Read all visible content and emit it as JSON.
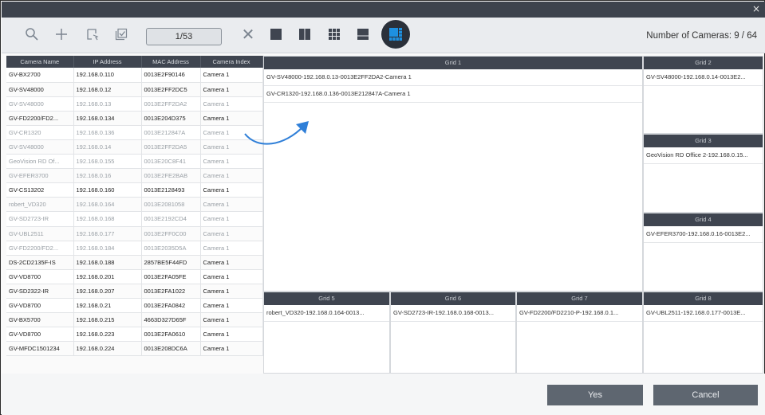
{
  "dialog": {
    "close_glyph": "×",
    "colors": {
      "titlebar": "#3d434d",
      "header": "#3f4550",
      "active_layout": "#1e90e0",
      "button": "#5e6670"
    }
  },
  "toolbar": {
    "icons": [
      "search-icon",
      "add-icon",
      "select-area-icon",
      "select-all-icon"
    ],
    "page_indicator": "1/53",
    "clear_glyph": "✕",
    "layouts": [
      "layout-1x1-icon",
      "layout-2x1-icon",
      "layout-3x3-icon",
      "layout-1plus2-icon",
      "layout-1plus7-icon"
    ],
    "camera_count": "Number of Cameras: 9 / 64"
  },
  "table": {
    "headers": [
      "Camera Name",
      "IP Address",
      "MAC Address",
      "Camera Index"
    ],
    "rows": [
      [
        "GV-BX2700",
        "192.168.0.110",
        "0013E2F90146",
        "Camera 1"
      ],
      [
        "GV-SV48000",
        "192.168.0.12",
        "0013E2FF2DC5",
        "Camera 1"
      ],
      [
        "GV-SV48000",
        "192.168.0.13",
        "0013E2FF2DA2",
        "Camera 1"
      ],
      [
        "GV-FD2200/FD2...",
        "192.168.0.134",
        "0013E204D375",
        "Camera 1"
      ],
      [
        "GV-CR1320",
        "192.168.0.136",
        "0013E212847A",
        "Camera 1"
      ],
      [
        "GV-SV48000",
        "192.168.0.14",
        "0013E2FF2DA5",
        "Camera 1"
      ],
      [
        "GeoVision RD Of...",
        "192.168.0.155",
        "0013E20C8F41",
        "Camera 1"
      ],
      [
        "GV-EFER3700",
        "192.168.0.16",
        "0013E2FE2BAB",
        "Camera 1"
      ],
      [
        "GV-CS13202",
        "192.168.0.160",
        "0013E2128493",
        "Camera 1"
      ],
      [
        "robert_VD320",
        "192.168.0.164",
        "0013E2081058",
        "Camera 1"
      ],
      [
        "GV-SD2723-IR",
        "192.168.0.168",
        "0013E2192CD4",
        "Camera 1"
      ],
      [
        "GV-UBL2511",
        "192.168.0.177",
        "0013E2FF0C00",
        "Camera 1"
      ],
      [
        "GV-FD2200/FD2...",
        "192.168.0.184",
        "0013E2035D5A",
        "Camera 1"
      ],
      [
        "DS-2CD2135F-IS",
        "192.168.0.188",
        "2857BE5F44FD",
        "Camera 1"
      ],
      [
        "GV-VD8700",
        "192.168.0.201",
        "0013E2FA05FE",
        "Camera 1"
      ],
      [
        "GV-SD2322-IR",
        "192.168.0.207",
        "0013E2FA1022",
        "Camera 1"
      ],
      [
        "GV-VD8700",
        "192.168.0.21",
        "0013E2FA0842",
        "Camera 1"
      ],
      [
        "GV-BX5700",
        "192.168.0.215",
        "4663D327D65F",
        "Camera 1"
      ],
      [
        "GV-VD8700",
        "192.168.0.223",
        "0013E2FA0610",
        "Camera 1"
      ],
      [
        "GV-MFDC1501234",
        "192.168.0.224",
        "0013E208DC6A",
        "Camera 1"
      ]
    ]
  },
  "grids": [
    {
      "label": "Grid 1",
      "entries": [
        "GV-SV48000-192.168.0.13-0013E2FF2DA2-Camera 1",
        "GV-CR1320-192.168.0.136-0013E212847A-Camera 1"
      ]
    },
    {
      "label": "Grid 2",
      "entries": [
        "GV-SV48000-192.168.0.14-0013E2..."
      ]
    },
    {
      "label": "Grid 3",
      "entries": [
        "GeoVision RD Office 2-192.168.0.15..."
      ]
    },
    {
      "label": "Grid 4",
      "entries": [
        "GV-EFER3700-192.168.0.16-0013E2..."
      ]
    },
    {
      "label": "Grid 5",
      "entries": [
        "robert_VD320-192.168.0.164-0013..."
      ]
    },
    {
      "label": "Grid 6",
      "entries": [
        "GV-SD2723-IR-192.168.0.168-0013..."
      ]
    },
    {
      "label": "Grid 7",
      "entries": [
        "GV-FD2200/FD2210-P-192.168.0.1..."
      ]
    },
    {
      "label": "Grid 8",
      "entries": [
        "GV-UBL2511-192.168.0.177-0013E..."
      ]
    }
  ],
  "footer": {
    "yes_label": "Yes",
    "cancel_label": "Cancel"
  }
}
